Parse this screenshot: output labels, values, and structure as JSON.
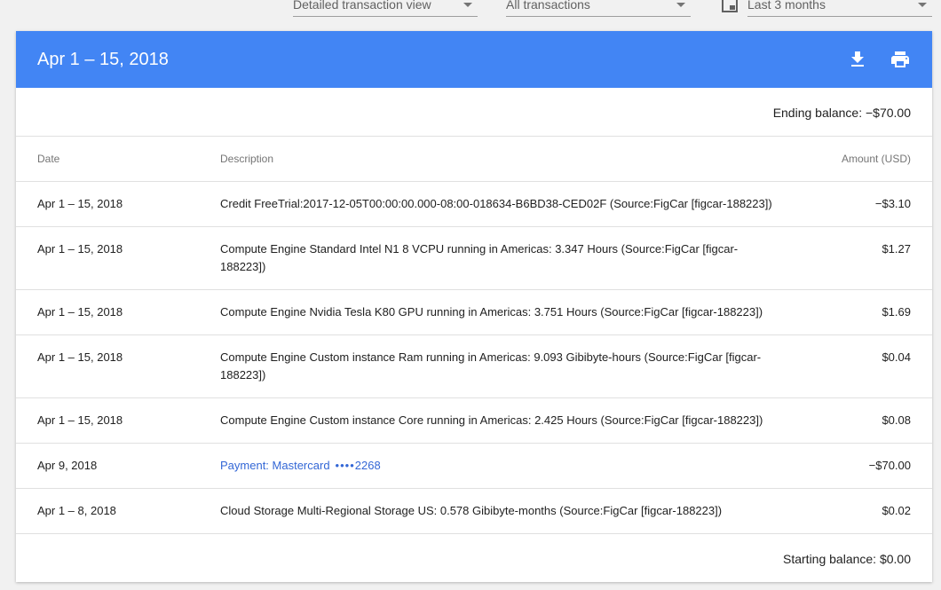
{
  "filters": {
    "view": "Detailed transaction view",
    "transactions": "All transactions",
    "range": "Last 3 months"
  },
  "card": {
    "title": "Apr 1 – 15, 2018",
    "ending_balance": "Ending balance: −$70.00",
    "starting_balance": "Starting balance: $0.00",
    "columns": {
      "date": "Date",
      "description": "Description",
      "amount": "Amount (USD)"
    },
    "rows": [
      {
        "date": "Apr 1 – 15, 2018",
        "description": "Credit FreeTrial:2017-12-05T00:00:00.000-08:00-018634-B6BD38-CED02F (Source:FigCar [figcar-188223])",
        "amount": "−$3.10"
      },
      {
        "date": "Apr 1 – 15, 2018",
        "description": "Compute Engine Standard Intel N1 8 VCPU running in Americas: 3.347 Hours (Source:FigCar [figcar-188223])",
        "amount": "$1.27"
      },
      {
        "date": "Apr 1 – 15, 2018",
        "description": "Compute Engine Nvidia Tesla K80 GPU running in Americas: 3.751 Hours (Source:FigCar [figcar-188223])",
        "amount": "$1.69"
      },
      {
        "date": "Apr 1 – 15, 2018",
        "description": "Compute Engine Custom instance Ram running in Americas: 9.093 Gibibyte-hours (Source:FigCar [figcar-188223])",
        "amount": "$0.04"
      },
      {
        "date": "Apr 1 – 15, 2018",
        "description": "Compute Engine Custom instance Core running in Americas: 2.425 Hours (Source:FigCar [figcar-188223])",
        "amount": "$0.08"
      },
      {
        "date": "Apr 9, 2018",
        "payment_label": "Payment: Mastercard",
        "payment_dots": "••••",
        "payment_last4": "2268",
        "amount": "−$70.00"
      },
      {
        "date": "Apr 1 – 8, 2018",
        "description": "Cloud Storage Multi-Regional Storage US: 0.578 Gibibyte-months (Source:FigCar [figcar-188223])",
        "amount": "$0.02"
      }
    ]
  },
  "icons": {
    "download": "download-icon",
    "print": "print-icon",
    "calendar": "date-range-icon"
  },
  "colors": {
    "header": "#4285f4",
    "link": "#3367d6"
  }
}
